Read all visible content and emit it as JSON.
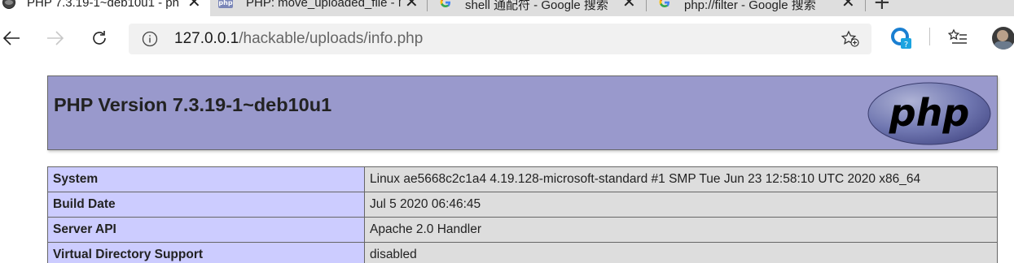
{
  "browser": {
    "tabs": [
      {
        "title": "PHP 7.3.19-1~deb10u1 - ph",
        "icon": "php-circle-icon",
        "active": true
      },
      {
        "title": "PHP: move_uploaded_file - M",
        "icon": "php-favicon-icon",
        "active": false
      },
      {
        "title": "shell 通配符 - Google 搜索",
        "icon": "google-g-icon",
        "active": false
      },
      {
        "title": "php://filter - Google 搜索",
        "icon": "google-g-icon",
        "active": false
      }
    ],
    "new_tab_label": "+",
    "address": {
      "host": "127.0.0.1",
      "path": "/hackable/uploads/info.php"
    }
  },
  "page": {
    "header_title": "PHP Version 7.3.19-1~deb10u1",
    "logo_text": "php",
    "rows": [
      {
        "key": "System",
        "value": "Linux ae5668c2c1a4 4.19.128-microsoft-standard #1 SMP Tue Jun 23 12:58:10 UTC 2020 x86_64"
      },
      {
        "key": "Build Date",
        "value": "Jul 5 2020 06:46:45"
      },
      {
        "key": "Server API",
        "value": "Apache 2.0 Handler"
      },
      {
        "key": "Virtual Directory Support",
        "value": "disabled"
      }
    ]
  },
  "colors": {
    "header_bg": "#9999cc",
    "key_cell_bg": "#ccccff",
    "value_cell_bg": "#dddddd",
    "tabstrip_bg": "#dedede",
    "address_bg": "#f1f1f1"
  }
}
